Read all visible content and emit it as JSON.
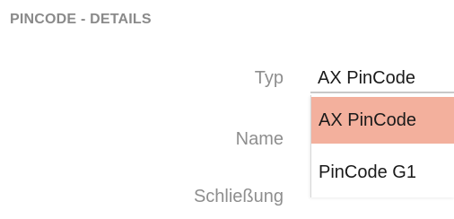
{
  "section": {
    "title": "PINCODE - DETAILS"
  },
  "fields": {
    "typ_label": "Typ",
    "name_label": "Name",
    "schliessung_label": "Schließung"
  },
  "typ_select": {
    "selected_value": "AX PinCode",
    "options": [
      {
        "label": "AX PinCode",
        "highlighted": true
      },
      {
        "label": "PinCode G1",
        "highlighted": false
      }
    ]
  },
  "colors": {
    "highlight": "#f3b09d",
    "label": "#8e8e8e",
    "title": "#8a8a8a"
  }
}
